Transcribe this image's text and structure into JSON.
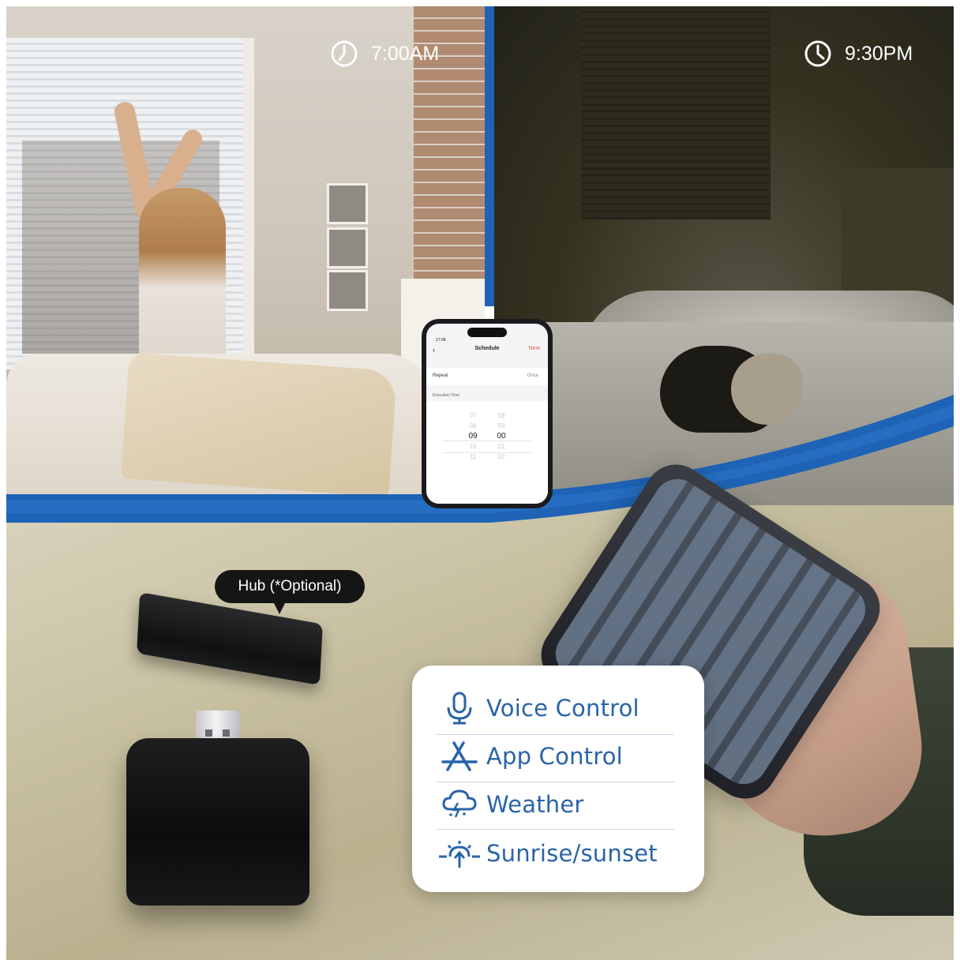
{
  "morning": {
    "time": "7:00AM"
  },
  "night": {
    "time": "9:30PM"
  },
  "phone_app": {
    "status_time": "17:08",
    "title": "Schedule",
    "next_label": "Next",
    "repeat_label": "Repeat",
    "repeat_value": "Once",
    "execution_time_label": "Execution Time",
    "hours": [
      "07",
      "08",
      "09",
      "10",
      "11"
    ],
    "minutes": [
      "58",
      "59",
      "00",
      "01",
      "02"
    ],
    "selected_hour": "09",
    "selected_minute": "00"
  },
  "hub": {
    "label": "Hub (*Optional)"
  },
  "features": [
    {
      "label": "Voice Control",
      "icon": "microphone-icon"
    },
    {
      "label": "App Control",
      "icon": "app-store-icon"
    },
    {
      "label": "Weather",
      "icon": "weather-cloud-icon"
    },
    {
      "label": "Sunrise/sunset",
      "icon": "sunrise-icon"
    }
  ],
  "colors": {
    "accent_blue": "#1e63b5",
    "feature_text": "#2a63a8"
  }
}
